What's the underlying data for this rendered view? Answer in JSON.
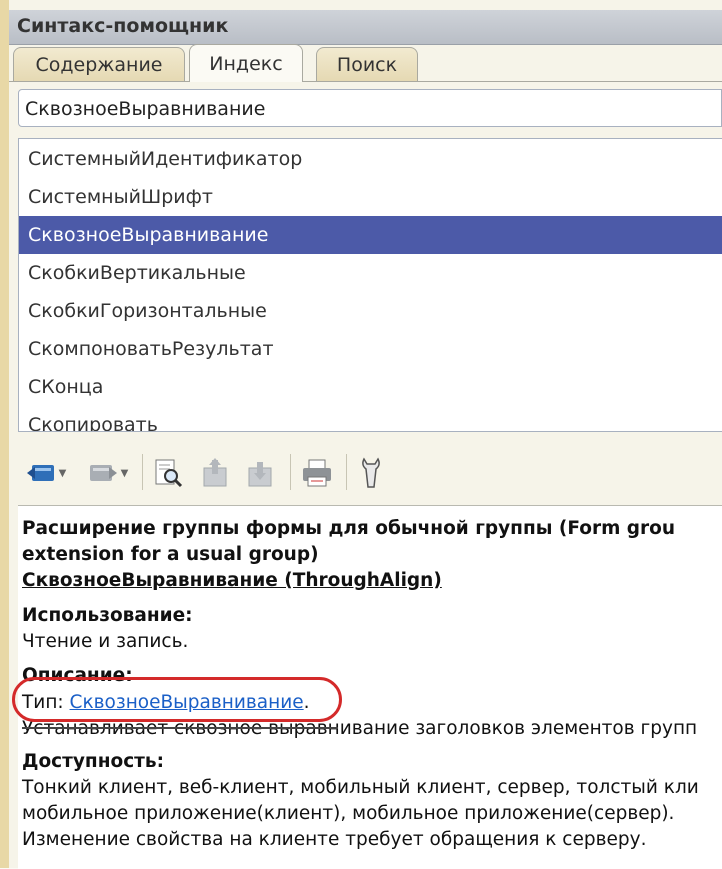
{
  "window": {
    "title": "Синтакс-помощник"
  },
  "tabs": [
    {
      "label": "Содержание",
      "active": false
    },
    {
      "label": "Индекс",
      "active": true
    },
    {
      "label": "Поиск",
      "active": false
    }
  ],
  "search": {
    "value": "СквозноеВыравнивание"
  },
  "index_list": {
    "items": [
      "СистемныйИдентификатор",
      "СистемныйШрифт",
      "СквозноеВыравнивание",
      "СкобкиВертикальные",
      "СкобкиГоризонтальные",
      "СкомпоноватьРезультат",
      "СКонца",
      "Скопировать"
    ],
    "selected_index": 2
  },
  "toolbar": {
    "icons": [
      "back-icon",
      "forward-icon",
      "find-in-contents-icon",
      "prev-topic-icon",
      "next-topic-icon",
      "print-icon",
      "settings-icon"
    ]
  },
  "help": {
    "heading_line1": "Расширение группы формы для обычной группы (Form grou",
    "heading_line2": "extension for a usual group)",
    "property_title": "СквозноеВыравнивание (ThroughAlign)",
    "usage_label": "Использование:",
    "usage_text": "Чтение и запись.",
    "description_label": "Описание:",
    "type_prefix": "Тип: ",
    "type_link": "СквозноеВыравнивание",
    "type_suffix": ".",
    "description_text": "Устанавливает сквозное выравнивание заголовков элементов групп",
    "availability_label": "Доступность:",
    "availability_line1": "Тонкий клиент, веб-клиент, мобильный клиент, сервер, толстый кли",
    "availability_line2": "мобильное приложение(клиент), мобильное приложение(сервер).",
    "availability_line3": "Изменение свойства на клиенте требует обращения к серверу."
  },
  "colors": {
    "selection": "#4c5aa8",
    "link": "#1a5fc7",
    "annotation": "#d42a2a"
  }
}
